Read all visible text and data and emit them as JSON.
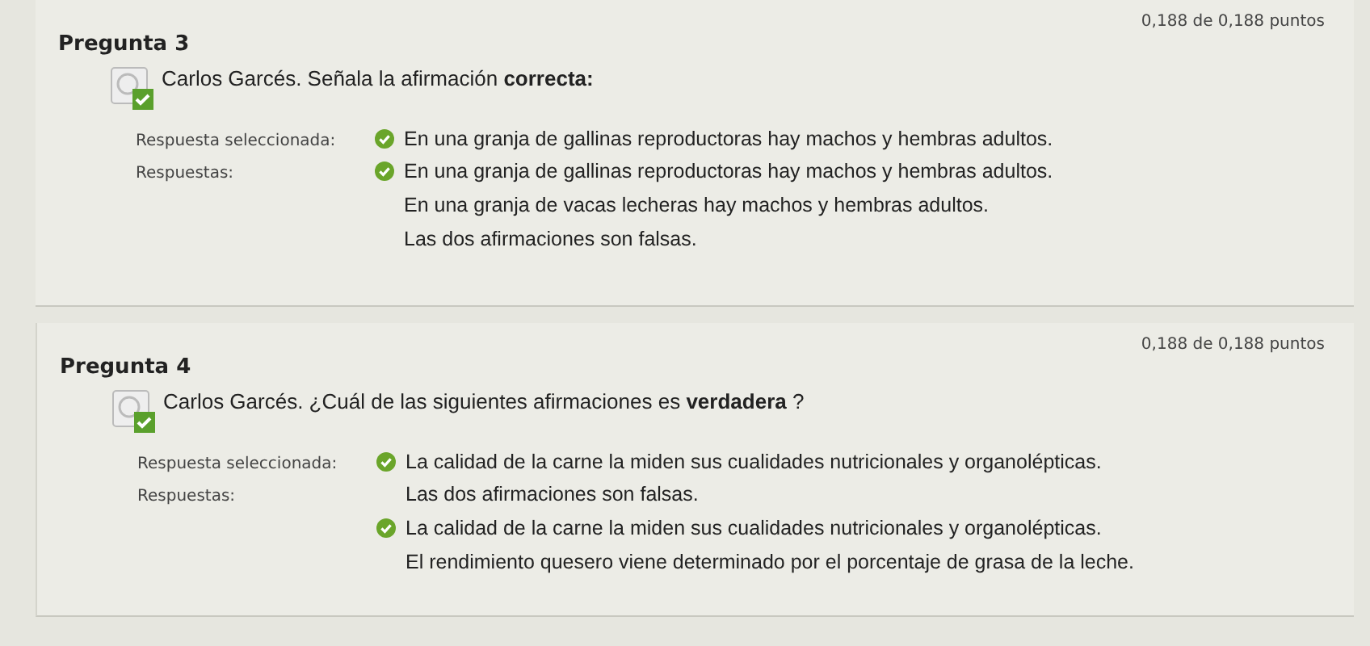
{
  "questions": [
    {
      "title": "Pregunta 3",
      "score": "0,188 de 0,188 puntos",
      "correct": true,
      "prompt": "Carlos Garcés. Señala la afirmación **correcta:**",
      "selected_label": "Respuesta seleccionada:",
      "selected_answer": {
        "text": "En una granja de gallinas reproductoras hay machos y hembras adultos.",
        "correct": true
      },
      "answers_label": "Respuestas:",
      "answers": [
        {
          "text": "En una granja de gallinas reproductoras hay machos y hembras adultos.",
          "correct": true
        },
        {
          "text": "En una granja de vacas lecheras hay machos y hembras adultos.",
          "correct": false
        },
        {
          "text": "Las dos afirmaciones son falsas.",
          "correct": false
        }
      ]
    },
    {
      "title": "Pregunta 4",
      "score": "0,188 de 0,188 puntos",
      "correct": true,
      "prompt": "Carlos Garcés. ¿Cuál de las siguientes afirmaciones es **verdadera** ?",
      "selected_label": "Respuesta seleccionada:",
      "selected_answer": {
        "text": "La calidad de la carne la miden sus cualidades nutricionales y organolépticas.",
        "correct": true
      },
      "answers_label": "Respuestas:",
      "answers": [
        {
          "text": "Las dos afirmaciones son falsas.",
          "correct": false
        },
        {
          "text": "La calidad de la carne la miden sus cualidades nutricionales y organolépticas.",
          "correct": true
        },
        {
          "text": "El rendimiento quesero viene determinado por el porcentaje de grasa de la leche.",
          "correct": false
        }
      ]
    }
  ]
}
